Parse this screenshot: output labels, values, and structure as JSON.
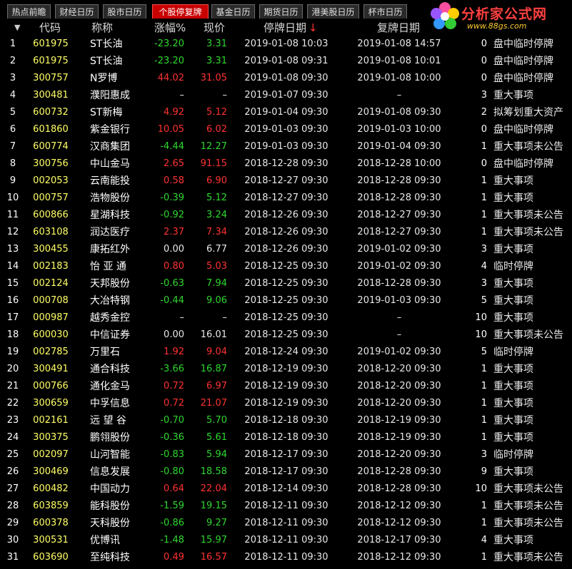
{
  "tabs": [
    {
      "label": "热点前瞻",
      "active": false
    },
    {
      "label": "财经日历",
      "active": false
    },
    {
      "label": "股市日历",
      "active": false
    },
    {
      "label": "个股停复牌",
      "active": true
    },
    {
      "label": "基金日历",
      "active": false
    },
    {
      "label": "期货日历",
      "active": false
    },
    {
      "label": "港美股日历",
      "active": false
    },
    {
      "label": "杯市日历",
      "active": false
    }
  ],
  "logo": {
    "brand": "分析家公式网",
    "url": "www.88gs.com"
  },
  "header": {
    "sort_arrow": "▼",
    "code": "代码",
    "name": "称称",
    "change": "涨幅%",
    "price": "现价",
    "stop_date": "停牌日期",
    "stop_sort_arrow": "↓",
    "resume_date": "复牌日期"
  },
  "colors": {
    "up": "#ff3232",
    "down": "#2ed82e",
    "code": "#ffff66",
    "active_tab": "#c80000"
  },
  "rows": [
    {
      "idx": "1",
      "code": "601975",
      "name": "ST长油",
      "chg": "-23.20",
      "price": "3.31",
      "dir": "down",
      "stop": "2019-01-08 10:03",
      "resume": "2019-01-08 14:57",
      "days": "0",
      "reason": "盘中临时停牌"
    },
    {
      "idx": "2",
      "code": "601975",
      "name": "ST长油",
      "chg": "-23.20",
      "price": "3.31",
      "dir": "down",
      "stop": "2019-01-08 09:31",
      "resume": "2019-01-08 10:01",
      "days": "0",
      "reason": "盘中临时停牌"
    },
    {
      "idx": "3",
      "code": "300757",
      "name": "N罗博",
      "chg": "44.02",
      "price": "31.05",
      "dir": "up",
      "stop": "2019-01-08 09:30",
      "resume": "2019-01-08 10:00",
      "days": "0",
      "reason": "盘中临时停牌"
    },
    {
      "idx": "4",
      "code": "300481",
      "name": "濮阳惠成",
      "chg": "–",
      "price": "–",
      "dir": "flat",
      "stop": "2019-01-07 09:30",
      "resume": "–",
      "days": "3",
      "reason": "重大事项"
    },
    {
      "idx": "5",
      "code": "600732",
      "name": "ST新梅",
      "chg": "4.92",
      "price": "5.12",
      "dir": "up",
      "stop": "2019-01-04 09:30",
      "resume": "2019-01-08 09:30",
      "days": "2",
      "reason": "拟筹划重大资产"
    },
    {
      "idx": "6",
      "code": "601860",
      "name": "紫金银行",
      "chg": "10.05",
      "price": "6.02",
      "dir": "up",
      "stop": "2019-01-03 09:30",
      "resume": "2019-01-03 10:00",
      "days": "0",
      "reason": "盘中临时停牌"
    },
    {
      "idx": "7",
      "code": "600774",
      "name": "汉商集团",
      "chg": "-4.44",
      "price": "12.27",
      "dir": "down",
      "stop": "2019-01-03 09:30",
      "resume": "2019-01-04 09:30",
      "days": "1",
      "reason": "重大事项未公告"
    },
    {
      "idx": "8",
      "code": "300756",
      "name": "中山金马",
      "chg": "2.65",
      "price": "91.15",
      "dir": "up",
      "stop": "2018-12-28 09:30",
      "resume": "2018-12-28 10:00",
      "days": "0",
      "reason": "盘中临时停牌"
    },
    {
      "idx": "9",
      "code": "002053",
      "name": "云南能投",
      "chg": "0.58",
      "price": "6.90",
      "dir": "up",
      "stop": "2018-12-27 09:30",
      "resume": "2018-12-28 09:30",
      "days": "1",
      "reason": "重大事项"
    },
    {
      "idx": "10",
      "code": "000757",
      "name": "浩物股份",
      "chg": "-0.39",
      "price": "5.12",
      "dir": "down",
      "stop": "2018-12-27 09:30",
      "resume": "2018-12-28 09:30",
      "days": "1",
      "reason": "重大事项"
    },
    {
      "idx": "11",
      "code": "600866",
      "name": "星湖科技",
      "chg": "-0.92",
      "price": "3.24",
      "dir": "down",
      "stop": "2018-12-26 09:30",
      "resume": "2018-12-27 09:30",
      "days": "1",
      "reason": "重大事项未公告"
    },
    {
      "idx": "12",
      "code": "603108",
      "name": "润达医疗",
      "chg": "2.37",
      "price": "7.34",
      "dir": "up",
      "stop": "2018-12-26 09:30",
      "resume": "2018-12-27 09:30",
      "days": "1",
      "reason": "重大事项未公告"
    },
    {
      "idx": "13",
      "code": "300455",
      "name": "康拓红外",
      "chg": "0.00",
      "price": "6.77",
      "dir": "flat",
      "stop": "2018-12-26 09:30",
      "resume": "2019-01-02 09:30",
      "days": "3",
      "reason": "重大事项"
    },
    {
      "idx": "14",
      "code": "002183",
      "name": "怡 亚 通",
      "chg": "0.80",
      "price": "5.03",
      "dir": "up",
      "stop": "2018-12-25 09:30",
      "resume": "2019-01-02 09:30",
      "days": "4",
      "reason": "临时停牌"
    },
    {
      "idx": "15",
      "code": "002124",
      "name": "天邦股份",
      "chg": "-0.63",
      "price": "7.94",
      "dir": "down",
      "stop": "2018-12-25 09:30",
      "resume": "2018-12-28 09:30",
      "days": "3",
      "reason": "重大事项"
    },
    {
      "idx": "16",
      "code": "000708",
      "name": "大冶特钢",
      "chg": "-0.44",
      "price": "9.06",
      "dir": "down",
      "stop": "2018-12-25 09:30",
      "resume": "2019-01-03 09:30",
      "days": "5",
      "reason": "重大事项"
    },
    {
      "idx": "17",
      "code": "000987",
      "name": "越秀金控",
      "chg": "–",
      "price": "–",
      "dir": "flat",
      "stop": "2018-12-25 09:30",
      "resume": "–",
      "days": "10",
      "reason": "重大事项"
    },
    {
      "idx": "18",
      "code": "600030",
      "name": "中信证券",
      "chg": "0.00",
      "price": "16.01",
      "dir": "flat",
      "stop": "2018-12-25 09:30",
      "resume": "–",
      "days": "10",
      "reason": "重大事项未公告"
    },
    {
      "idx": "19",
      "code": "002785",
      "name": "万里石",
      "chg": "1.92",
      "price": "9.04",
      "dir": "up",
      "stop": "2018-12-24 09:30",
      "resume": "2019-01-02 09:30",
      "days": "5",
      "reason": "临时停牌"
    },
    {
      "idx": "20",
      "code": "300491",
      "name": "通合科技",
      "chg": "-3.66",
      "price": "16.87",
      "dir": "down",
      "stop": "2018-12-19 09:30",
      "resume": "2018-12-20 09:30",
      "days": "1",
      "reason": "重大事项"
    },
    {
      "idx": "21",
      "code": "000766",
      "name": "通化金马",
      "chg": "0.72",
      "price": "6.97",
      "dir": "up",
      "stop": "2018-12-19 09:30",
      "resume": "2018-12-20 09:30",
      "days": "1",
      "reason": "重大事项"
    },
    {
      "idx": "22",
      "code": "300659",
      "name": "中孚信息",
      "chg": "0.72",
      "price": "21.07",
      "dir": "up",
      "stop": "2018-12-19 09:30",
      "resume": "2018-12-20 09:30",
      "days": "1",
      "reason": "重大事项"
    },
    {
      "idx": "23",
      "code": "002161",
      "name": "远 望 谷",
      "chg": "-0.70",
      "price": "5.70",
      "dir": "down",
      "stop": "2018-12-18 09:30",
      "resume": "2018-12-19 09:30",
      "days": "1",
      "reason": "重大事项"
    },
    {
      "idx": "24",
      "code": "300375",
      "name": "鹏翎股份",
      "chg": "-0.36",
      "price": "5.61",
      "dir": "down",
      "stop": "2018-12-18 09:30",
      "resume": "2018-12-19 09:30",
      "days": "1",
      "reason": "重大事项"
    },
    {
      "idx": "25",
      "code": "002097",
      "name": "山河智能",
      "chg": "-0.83",
      "price": "5.94",
      "dir": "down",
      "stop": "2018-12-17 09:30",
      "resume": "2018-12-20 09:30",
      "days": "3",
      "reason": "临时停牌"
    },
    {
      "idx": "26",
      "code": "300469",
      "name": "信息发展",
      "chg": "-0.80",
      "price": "18.58",
      "dir": "down",
      "stop": "2018-12-17 09:30",
      "resume": "2018-12-28 09:30",
      "days": "9",
      "reason": "重大事项"
    },
    {
      "idx": "27",
      "code": "600482",
      "name": "中国动力",
      "chg": "0.64",
      "price": "22.04",
      "dir": "up",
      "stop": "2018-12-14 09:30",
      "resume": "2018-12-28 09:30",
      "days": "10",
      "reason": "重大事项未公告"
    },
    {
      "idx": "28",
      "code": "603859",
      "name": "能科股份",
      "chg": "-1.59",
      "price": "19.15",
      "dir": "down",
      "stop": "2018-12-11 09:30",
      "resume": "2018-12-12 09:30",
      "days": "1",
      "reason": "重大事项未公告"
    },
    {
      "idx": "29",
      "code": "600378",
      "name": "天科股份",
      "chg": "-0.86",
      "price": "9.27",
      "dir": "down",
      "stop": "2018-12-11 09:30",
      "resume": "2018-12-12 09:30",
      "days": "1",
      "reason": "重大事项未公告"
    },
    {
      "idx": "30",
      "code": "300531",
      "name": "优博讯",
      "chg": "-1.48",
      "price": "15.97",
      "dir": "down",
      "stop": "2018-12-11 09:30",
      "resume": "2018-12-17 09:30",
      "days": "4",
      "reason": "重大事项"
    },
    {
      "idx": "31",
      "code": "603690",
      "name": "至纯科技",
      "chg": "0.49",
      "price": "16.57",
      "dir": "up",
      "stop": "2018-12-11 09:30",
      "resume": "2018-12-12 09:30",
      "days": "1",
      "reason": "重大事项未公告"
    }
  ]
}
